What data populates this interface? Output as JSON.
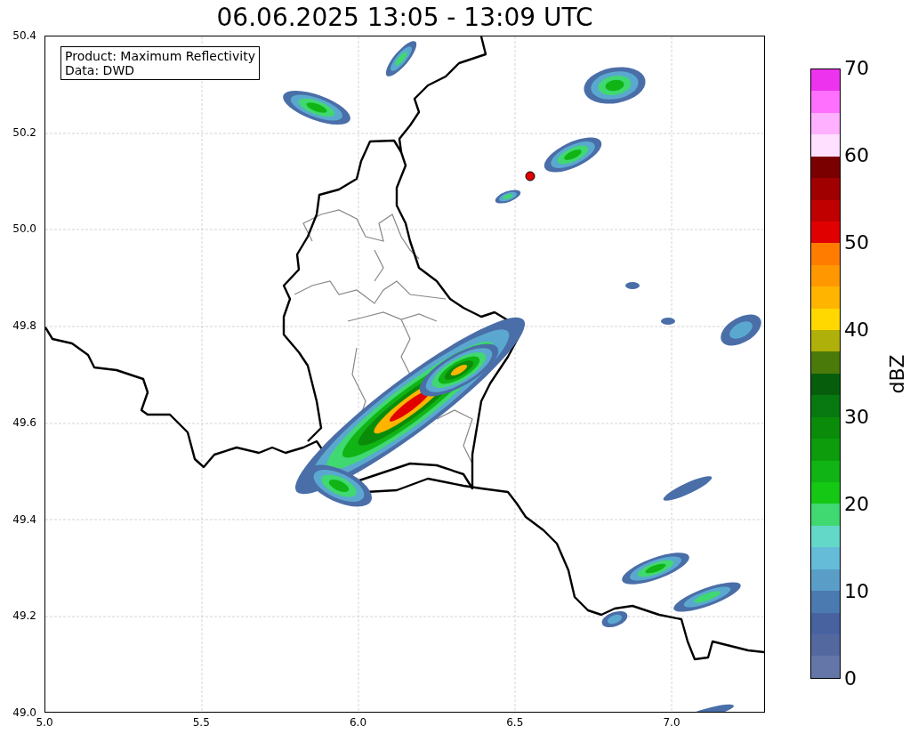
{
  "title": "06.06.2025 13:05 - 13:09 UTC",
  "legend": {
    "lines": [
      "Product: Maximum Reflectivity",
      "Data: DWD"
    ]
  },
  "x_axis": {
    "ticks": [
      "5.0",
      "5.5",
      "6.0",
      "6.5",
      "7.0"
    ]
  },
  "y_axis": {
    "ticks": [
      "50.4",
      "50.2",
      "50.0",
      "49.8",
      "49.6",
      "49.4",
      "49.2",
      "49.0"
    ]
  },
  "colorbar": {
    "label": "dBZ",
    "ticks": [
      "70",
      "60",
      "50",
      "40",
      "30",
      "20",
      "10",
      "0"
    ],
    "segments": [
      {
        "color": "#ee33ee"
      },
      {
        "color": "#ff70ff"
      },
      {
        "color": "#ffb0ff"
      },
      {
        "color": "#ffe0ff"
      },
      {
        "color": "#7a0000"
      },
      {
        "color": "#a00000"
      },
      {
        "color": "#c00000"
      },
      {
        "color": "#e00000"
      },
      {
        "color": "#ff7c00"
      },
      {
        "color": "#ff9800"
      },
      {
        "color": "#ffb400"
      },
      {
        "color": "#ffd800"
      },
      {
        "color": "#b0b00a"
      },
      {
        "color": "#4a7a0a"
      },
      {
        "color": "#065e0c"
      },
      {
        "color": "#087810"
      },
      {
        "color": "#0a8c0a"
      },
      {
        "color": "#0c9c0c"
      },
      {
        "color": "#10b414"
      },
      {
        "color": "#14c814"
      },
      {
        "color": "#40d870"
      },
      {
        "color": "#64d8c8"
      },
      {
        "color": "#64bcd8"
      },
      {
        "color": "#5a9ec8"
      },
      {
        "color": "#4a7ab0"
      },
      {
        "color": "#4862a0"
      },
      {
        "color": "#5468a0"
      },
      {
        "color": "#6476a8"
      }
    ]
  }
}
